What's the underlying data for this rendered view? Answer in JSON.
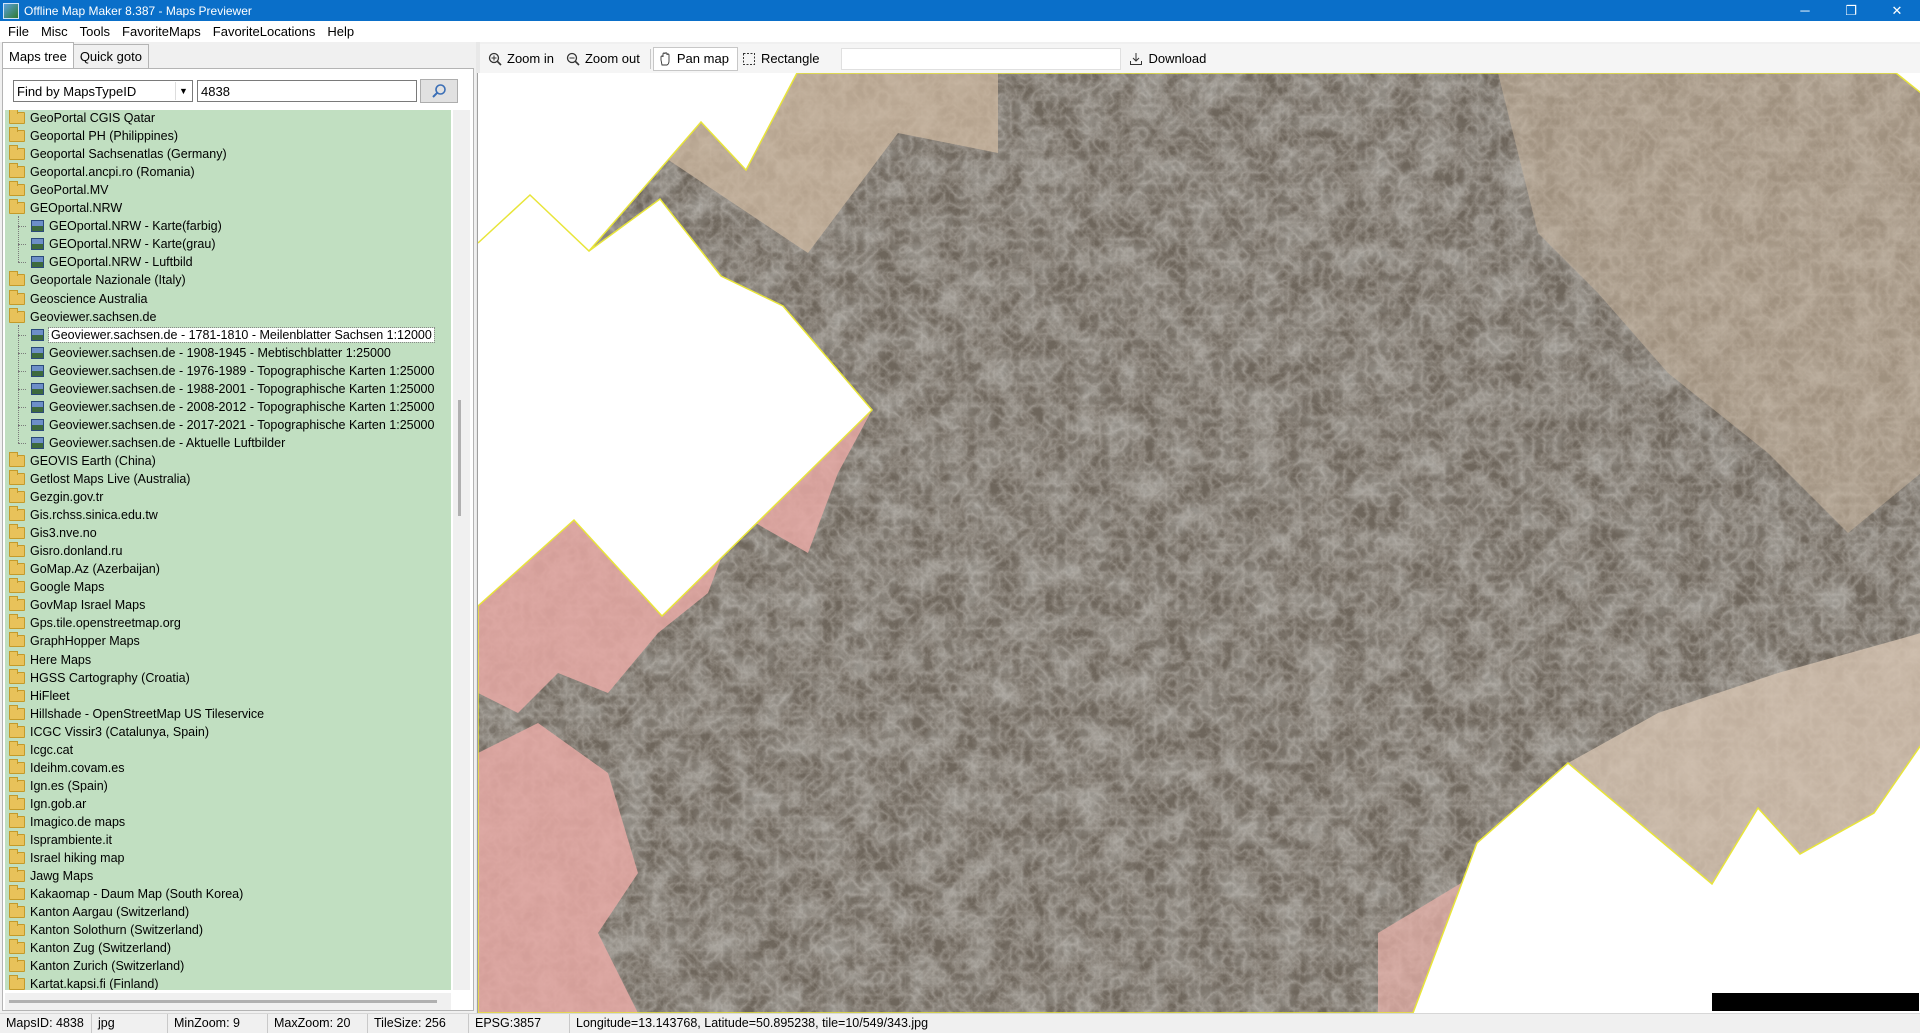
{
  "window": {
    "title": "Offline Map Maker 8.387 - Maps Previewer",
    "minimize": "─",
    "maximize": "❐",
    "close": "✕"
  },
  "menu": [
    "File",
    "Misc",
    "Tools",
    "FavoriteMaps",
    "FavoriteLocations",
    "Help"
  ],
  "tabs": {
    "maps_tree": "Maps tree",
    "quick_goto": "Quick goto"
  },
  "find": {
    "mode": "Find by MapsTypeID",
    "query": "4838",
    "button_icon": "search-icon"
  },
  "tree": [
    {
      "label": "GeoPortal CGIS Qatar",
      "type": "folder",
      "level": 0
    },
    {
      "label": "Geoportal PH (Philippines)",
      "type": "folder",
      "level": 0
    },
    {
      "label": "Geoportal Sachsenatlas (Germany)",
      "type": "folder",
      "level": 0
    },
    {
      "label": "Geoportal.ancpi.ro (Romania)",
      "type": "folder",
      "level": 0
    },
    {
      "label": "GeoPortal.MV",
      "type": "folder",
      "level": 0
    },
    {
      "label": "GEOportal.NRW",
      "type": "folder-open",
      "level": 0
    },
    {
      "label": "GEOportal.NRW - Karte(farbig)",
      "type": "map",
      "level": 1
    },
    {
      "label": "GEOportal.NRW - Karte(grau)",
      "type": "map",
      "level": 1
    },
    {
      "label": "GEOportal.NRW - Luftbild",
      "type": "map",
      "level": 1
    },
    {
      "label": "Geoportale Nazionale (Italy)",
      "type": "folder",
      "level": 0
    },
    {
      "label": "Geoscience Australia",
      "type": "folder",
      "level": 0
    },
    {
      "label": "Geoviewer.sachsen.de",
      "type": "folder-open",
      "level": 0
    },
    {
      "label": "Geoviewer.sachsen.de - 1781-1810 - Meilenblatter Sachsen 1:12000",
      "type": "map",
      "level": 1,
      "selected": true
    },
    {
      "label": "Geoviewer.sachsen.de - 1908-1945 - Mebtischblatter 1:25000",
      "type": "map",
      "level": 1
    },
    {
      "label": "Geoviewer.sachsen.de - 1976-1989 - Topographische Karten 1:25000",
      "type": "map",
      "level": 1
    },
    {
      "label": "Geoviewer.sachsen.de - 1988-2001 - Topographische Karten 1:25000",
      "type": "map",
      "level": 1
    },
    {
      "label": "Geoviewer.sachsen.de - 2008-2012 - Topographische Karten 1:25000",
      "type": "map",
      "level": 1
    },
    {
      "label": "Geoviewer.sachsen.de - 2017-2021 - Topographische Karten 1:25000",
      "type": "map",
      "level": 1
    },
    {
      "label": "Geoviewer.sachsen.de - Aktuelle Luftbilder",
      "type": "map",
      "level": 1
    },
    {
      "label": "GEOVIS Earth (China)",
      "type": "folder",
      "level": 0
    },
    {
      "label": "Getlost Maps Live (Australia)",
      "type": "folder",
      "level": 0
    },
    {
      "label": "Gezgin.gov.tr",
      "type": "folder",
      "level": 0
    },
    {
      "label": "Gis.rchss.sinica.edu.tw",
      "type": "folder",
      "level": 0
    },
    {
      "label": "Gis3.nve.no",
      "type": "folder",
      "level": 0
    },
    {
      "label": "Gisro.donland.ru",
      "type": "folder",
      "level": 0
    },
    {
      "label": "GoMap.Az (Azerbaijan)",
      "type": "folder",
      "level": 0
    },
    {
      "label": "Google Maps",
      "type": "folder",
      "level": 0
    },
    {
      "label": "GovMap Israel Maps",
      "type": "folder",
      "level": 0
    },
    {
      "label": "Gps.tile.openstreetmap.org",
      "type": "folder",
      "level": 0
    },
    {
      "label": "GraphHopper Maps",
      "type": "folder",
      "level": 0
    },
    {
      "label": "Here Maps",
      "type": "folder",
      "level": 0
    },
    {
      "label": "HGSS Cartography (Croatia)",
      "type": "folder",
      "level": 0
    },
    {
      "label": "HiFleet",
      "type": "folder",
      "level": 0
    },
    {
      "label": "Hillshade - OpenStreetMap US Tileservice",
      "type": "folder",
      "level": 0
    },
    {
      "label": "ICGC Vissir3 (Catalunya, Spain)",
      "type": "folder",
      "level": 0
    },
    {
      "label": "Icgc.cat",
      "type": "folder",
      "level": 0
    },
    {
      "label": "Ideihm.covam.es",
      "type": "folder",
      "level": 0
    },
    {
      "label": "Ign.es (Spain)",
      "type": "folder",
      "level": 0
    },
    {
      "label": "Ign.gob.ar",
      "type": "folder",
      "level": 0
    },
    {
      "label": "Imagico.de maps",
      "type": "folder",
      "level": 0
    },
    {
      "label": "Isprambiente.it",
      "type": "folder",
      "level": 0
    },
    {
      "label": "Israel hiking map",
      "type": "folder",
      "level": 0
    },
    {
      "label": "Jawg Maps",
      "type": "folder",
      "level": 0
    },
    {
      "label": "Kakaomap - Daum Map (South Korea)",
      "type": "folder",
      "level": 0
    },
    {
      "label": "Kanton Aargau (Switzerland)",
      "type": "folder",
      "level": 0
    },
    {
      "label": "Kanton Solothurn (Switzerland)",
      "type": "folder",
      "level": 0
    },
    {
      "label": "Kanton Zug (Switzerland)",
      "type": "folder",
      "level": 0
    },
    {
      "label": "Kanton Zurich (Switzerland)",
      "type": "folder",
      "level": 0
    },
    {
      "label": "Kartat.kapsi.fi (Finland)",
      "type": "folder",
      "level": 0
    }
  ],
  "toolbar": {
    "zoom_in": "Zoom in",
    "zoom_out": "Zoom out",
    "pan_map": "Pan map",
    "rectangle": "Rectangle",
    "download": "Download"
  },
  "status": {
    "maps_id": "MapsID: 4838",
    "format": "jpg",
    "min_zoom": "MinZoom: 9",
    "max_zoom": "MaxZoom: 20",
    "tile_size": "TileSize: 256",
    "epsg": "EPSG:3857",
    "coords": "Longitude=13.143768, Latitude=50.895238, tile=10/549/343.jpg"
  },
  "colors": {
    "titlebar": "#0a6fc9",
    "tree_bg": "#c1dfc1",
    "map_terrain": "#5a534b",
    "map_pink": "#e3a8a3",
    "map_parchment": "#cbb69c",
    "map_border": "#e8e53a"
  }
}
